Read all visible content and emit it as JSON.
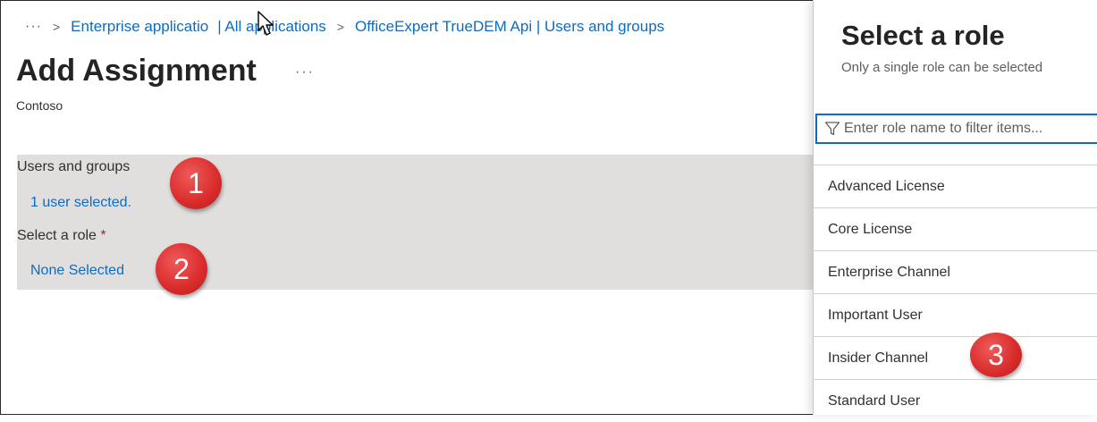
{
  "breadcrumb": {
    "more": "···",
    "items": [
      "Enterprise applications | All applications",
      "OfficeExpert TrueDEM Api | Users and groups"
    ],
    "item1_visible": "Enterprise applicatio",
    "item1_rest": "| All applications",
    "item2": "OfficeExpert TrueDEM Api | Users and groups"
  },
  "page": {
    "title": "Add Assignment",
    "more": "···",
    "subtitle": "Contoso"
  },
  "form": {
    "users_label": "Users and groups",
    "users_value": "1 user selected.",
    "role_label": "Select a role",
    "required_marker": "*",
    "role_value": "None Selected"
  },
  "badges": [
    "1",
    "2",
    "3"
  ],
  "panel": {
    "title": "Select a role",
    "subtitle": "Only a single role can be selected",
    "filter_placeholder": "Enter role name to filter items...",
    "roles": [
      "Advanced License",
      "Core License",
      "Enterprise Channel",
      "Important User",
      "Insider Channel",
      "Standard User"
    ]
  },
  "colors": {
    "link": "#0f6cbd",
    "highlight": "#e1dfdd",
    "badge": "#d92b2b",
    "required": "#a4262c"
  }
}
